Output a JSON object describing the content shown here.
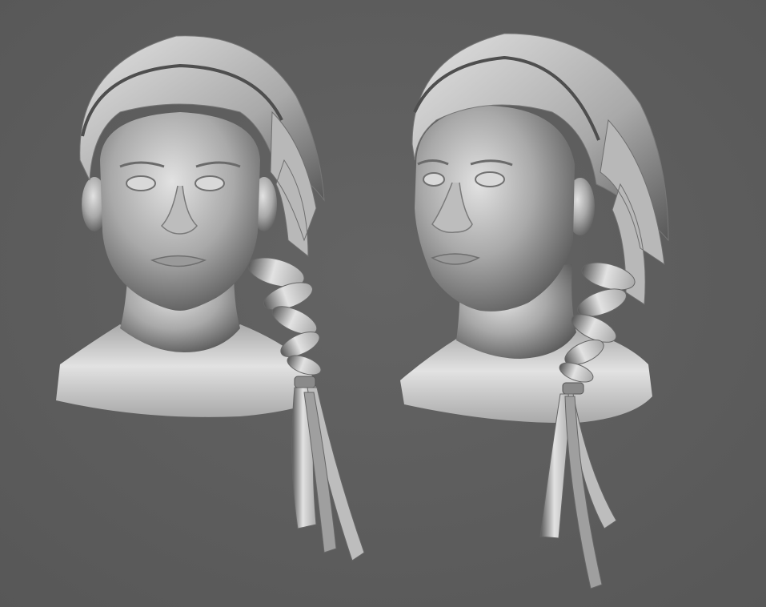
{
  "scene": {
    "background": "#5e5e5e",
    "clay_light": "#e2e2e2",
    "clay_mid": "#a9a9a9",
    "clay_dark": "#585858",
    "models": [
      {
        "view": "front"
      },
      {
        "view": "three-quarter"
      }
    ]
  }
}
